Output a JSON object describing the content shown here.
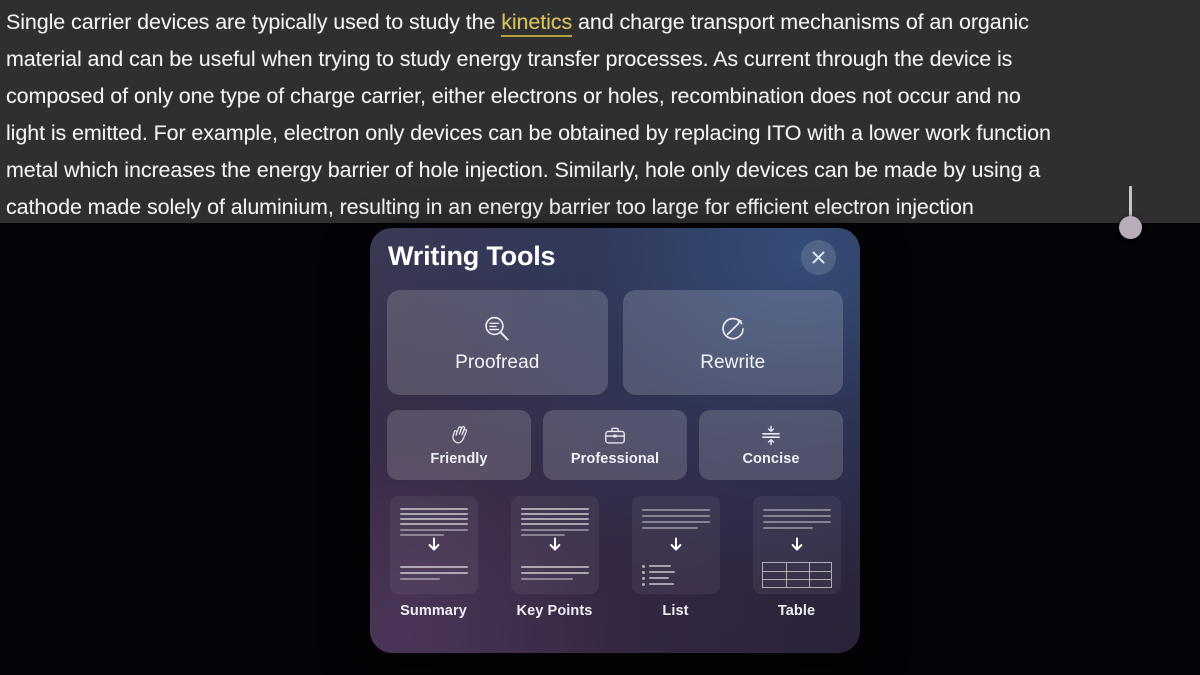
{
  "document": {
    "selection_background": "#2f2f2f",
    "link_color": "#d8c35a",
    "lines": [
      "Single carrier devices are typically used to study the ",
      "material and can be useful when trying to study energy transfer processes. As current through the device is",
      "composed of only one type of charge carrier, either electrons or holes, recombination does not occur and no",
      "light is emitted. For example, electron only devices can be obtained by replacing ITO with a lower work function",
      "metal which increases the energy barrier of hole injection. Similarly, hole only devices can be made by using a",
      "cathode made solely of aluminium, resulting in an energy barrier too large for efficient electron injection"
    ],
    "line1_link": "kinetics",
    "line1_after_link": " and charge transport mechanisms of an organic"
  },
  "panel": {
    "title": "Writing Tools",
    "close_icon": "close-icon",
    "primary_actions": [
      {
        "label": "Proofread",
        "icon": "magnifier-text-icon"
      },
      {
        "label": "Rewrite",
        "icon": "rewrite-wand-icon"
      }
    ],
    "tone_actions": [
      {
        "label": "Friendly",
        "icon": "waving-hand-icon"
      },
      {
        "label": "Professional",
        "icon": "briefcase-icon"
      },
      {
        "label": "Concise",
        "icon": "compress-icon"
      }
    ],
    "format_actions": [
      {
        "label": "Summary",
        "icon": "summary-doc-icon"
      },
      {
        "label": "Key Points",
        "icon": "key-points-doc-icon"
      },
      {
        "label": "List",
        "icon": "list-doc-icon"
      },
      {
        "label": "Table",
        "icon": "table-doc-icon"
      }
    ]
  },
  "colors": {
    "page_background": "#050307",
    "panel_gradient_top_right": "#344e7a",
    "panel_gradient_bottom_left": "#4d3658",
    "tile_fill": "rgba(255,255,255,0.17)"
  }
}
